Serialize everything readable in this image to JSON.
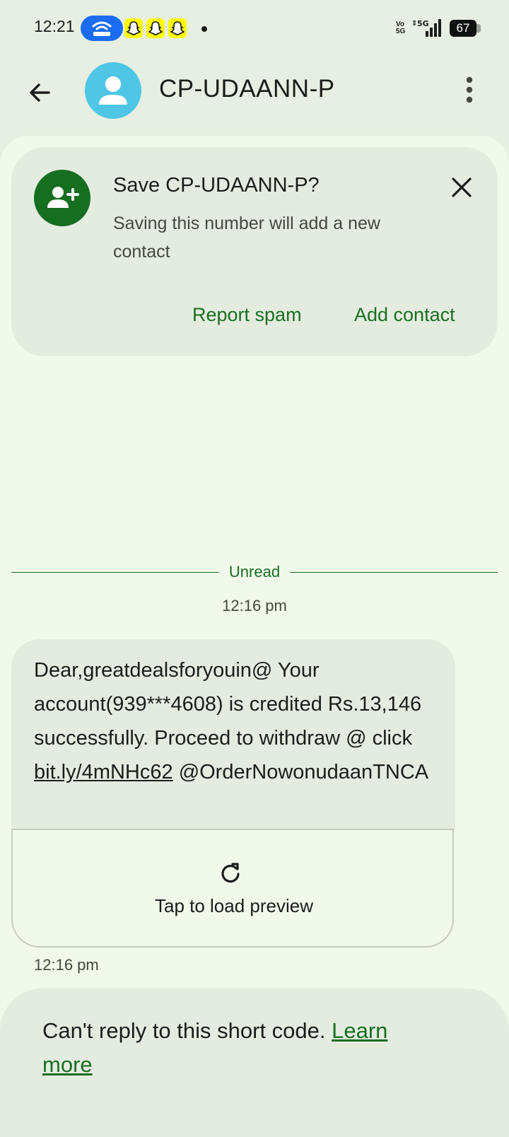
{
  "status_bar": {
    "time": "12:21",
    "volte": "Vo 5G",
    "network": "5G",
    "battery": "67",
    "icons": [
      "hotspot-icon",
      "snapchat-icon",
      "snapchat-icon",
      "snapchat-icon",
      "notification-dot",
      "signal-icon",
      "battery-icon"
    ]
  },
  "header": {
    "contact_name": "CP-UDAANN-P",
    "icons": [
      "back-arrow-icon",
      "person-icon",
      "more-vert-icon"
    ]
  },
  "save_card": {
    "title": "Save CP-UDAANN-P?",
    "body": "Saving this number will add a new contact",
    "report_spam": "Report spam",
    "add_contact": "Add contact",
    "icons": [
      "person-add-icon",
      "close-icon"
    ]
  },
  "divider": {
    "label": "Unread",
    "time": "12:16 pm"
  },
  "message": {
    "text_before_link": "Dear,greatdealsforyouin@ Your account(939***4608) is credited Rs.13,146 successfully. Proceed to withdraw @ click ",
    "link": "bit.ly/4mNHc62",
    "text_after_link": "@OrderNowonudaanTNCA",
    "preview_label": "Tap to load preview",
    "time": "12:16 pm"
  },
  "reply_notice": {
    "text": "Can't reply to this short code. ",
    "link": "Learn more"
  },
  "colors": {
    "accent_green": "#1a6e22",
    "avatar_blue": "#4fc6e6",
    "hotspot_blue": "#1b6cf2",
    "snapchat_yellow": "#fffc00",
    "background": "#e6efe1",
    "panel": "#f1f9eb",
    "card": "#e4ece0"
  }
}
